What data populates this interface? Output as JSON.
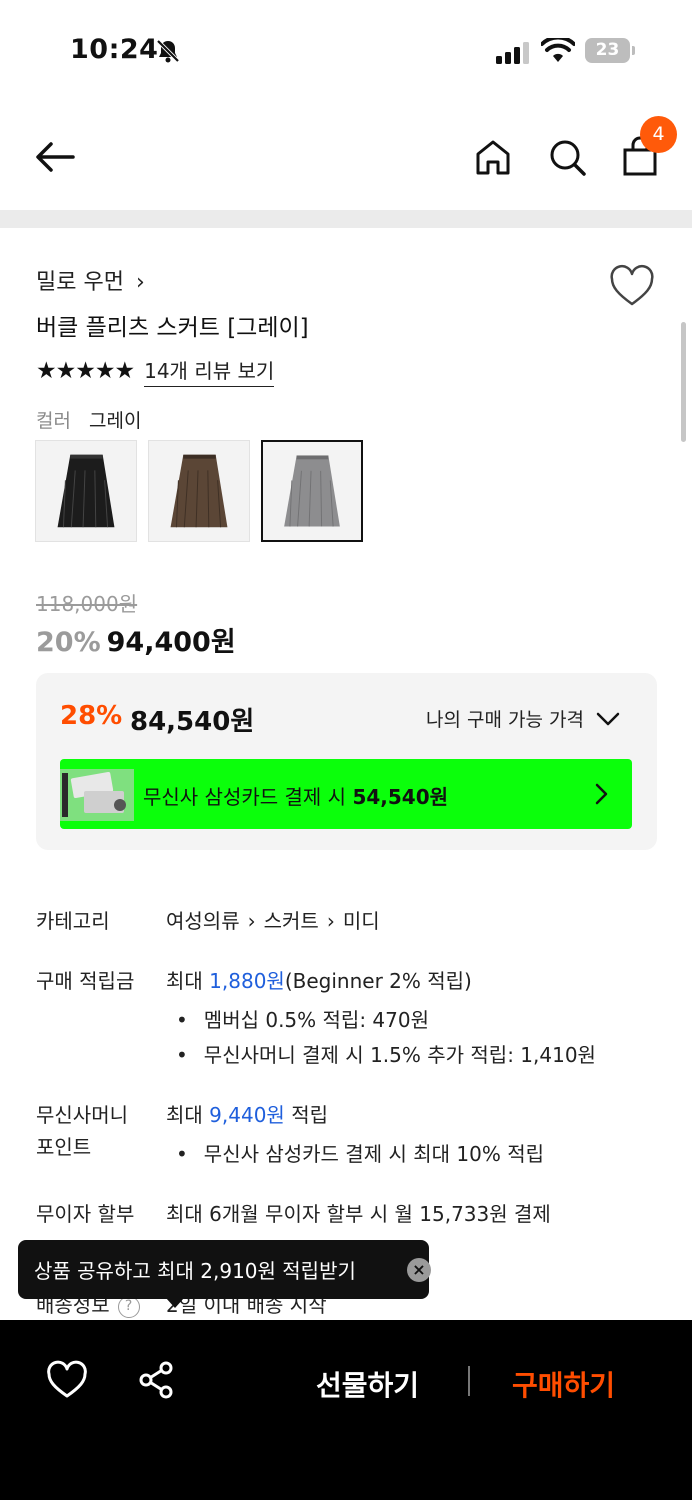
{
  "status_bar": {
    "time": "10:24",
    "battery": "23"
  },
  "nav": {
    "cart_count": "4"
  },
  "product": {
    "brand": "밀로 우먼",
    "title": "버클 플리츠 스커트 [그레이]",
    "stars": "★★★★★",
    "review_link": "14개 리뷰 보기",
    "color_label": "컬러",
    "color_value": "그레이",
    "swatches": [
      {
        "name": "black",
        "color": "#1c1c1c"
      },
      {
        "name": "brown",
        "color": "#5b4636"
      },
      {
        "name": "gray",
        "color": "#8d8d8f"
      }
    ],
    "original_price": "118,000원",
    "discount_percent": "20%",
    "sale_price": "94,400원"
  },
  "benefit": {
    "percent": "28%",
    "price": "84,540원",
    "toggle_label": "나의 구매 가능 가격",
    "card_text_prefix": "무신사 삼성카드 결제 시",
    "card_price": "54,540원",
    "banner_color": "#0bff0b"
  },
  "info": {
    "category_label": "카테고리",
    "category_path": [
      "여성의류",
      "스커트",
      "미디"
    ],
    "points_label": "구매 적립금",
    "points_prefix": "최대",
    "points_amount": "1,880원",
    "points_suffix": "(Beginner 2% 적립)",
    "points_bullets": [
      "멤버십 0.5% 적립: 470원",
      "무신사머니 결제 시 1.5% 추가 적립: 1,410원"
    ],
    "money_label_1": "무신사머니",
    "money_label_2": "포인트",
    "money_prefix": "최대",
    "money_amount": "9,440원",
    "money_suffix": "적립",
    "money_bullets": [
      "무신사 삼성카드 결제 시 최대 10% 적립"
    ],
    "installment_label": "무이자 할부",
    "installment_value": "최대 6개월 무이자 할부 시 월 15,733원 결제",
    "delivery_label": "배송정보",
    "delivery_value": "2일 이내 배송 시작"
  },
  "toast": {
    "text": "상품 공유하고 최대 2,910원 적립받기"
  },
  "bottom": {
    "gift_label": "선물하기",
    "buy_label": "구매하기"
  },
  "colors": {
    "accent": "#ff4d00",
    "badge": "#ff5a0a",
    "link_blue": "#1f5fdc"
  }
}
